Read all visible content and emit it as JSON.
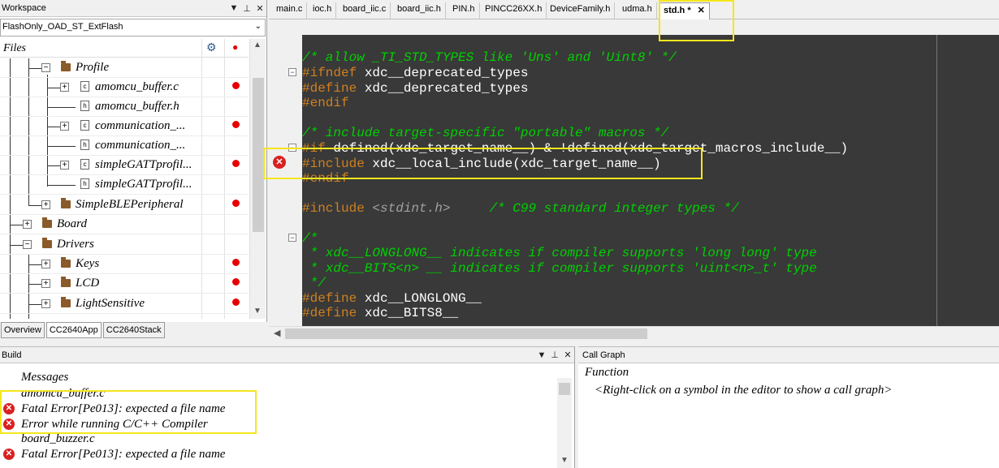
{
  "workspace": {
    "title": "Workspace",
    "pin_icon": "pin-icon",
    "configuration": "FlashOnly_OAD_ST_ExtFlash",
    "files_header": "Files",
    "tree": [
      {
        "label": "Profile",
        "type": "folder",
        "expanded": true
      },
      {
        "label": "amomcu_buffer.c",
        "type": "file"
      },
      {
        "label": "amomcu_buffer.h",
        "type": "file"
      },
      {
        "label": "communication_...",
        "type": "file"
      },
      {
        "label": "communication_...",
        "type": "file"
      },
      {
        "label": "simpleGATTprofil...",
        "type": "file"
      },
      {
        "label": "simpleGATTprofil...",
        "type": "file"
      },
      {
        "label": "SimpleBLEPeripheral",
        "type": "folder"
      },
      {
        "label": "Board",
        "type": "folder"
      },
      {
        "label": "Drivers",
        "type": "folder",
        "expanded": true
      },
      {
        "label": "Keys",
        "type": "folder"
      },
      {
        "label": "LCD",
        "type": "folder"
      },
      {
        "label": "LightSensitive",
        "type": "folder"
      }
    ],
    "tabs": [
      "Overview",
      "CC2640App",
      "CC2640Stack"
    ]
  },
  "editor": {
    "tabs": [
      "main.c",
      "ioc.h",
      "board_iic.c",
      "board_iic.h",
      "PIN.h",
      "PINCC26XX.h",
      "DeviceFamily.h",
      "udma.h",
      "std.h *"
    ],
    "close_glyph": "✕",
    "lines": {
      "l1": "/* allow _TI_STD_TYPES like 'Uns' and 'Uint8' */",
      "l2a": "#ifndef",
      "l2b": " xdc__deprecated_types",
      "l3a": "#define",
      "l3b": " xdc__deprecated_types",
      "l4": "#endif",
      "l5": "/* include target-specific \"portable\" macros */",
      "l6a": "#if",
      "l6b": " defined(xdc_target_name__) & !defined(xdc_target_macros_include__)",
      "l7a": "#include",
      "l7b": " xdc__local_include(xdc_target_name__)",
      "l8": "#endif",
      "l9a": "#include",
      "l9b": " <stdint.h>",
      "l9c": "     /* C99 standard integer types */",
      "l10": "/*",
      "l11": " * xdc__LONGLONG__ indicates if compiler supports 'long long' type",
      "l12": " * xdc__BITS<n> __ indicates if compiler supports 'uint<n>_t' type",
      "l13": " */",
      "l14a": "#define",
      "l14b": " xdc__LONGLONG__",
      "l15a": "#define",
      "l15b": " xdc__BITS8__"
    }
  },
  "build": {
    "title": "Build",
    "header": "Messages",
    "messages": [
      {
        "text": "amomcu_buffer.c",
        "error": false
      },
      {
        "text": "Fatal Error[Pe013]: expected a file name",
        "error": true
      },
      {
        "text": "Error while running C/C++ Compiler",
        "error": true
      },
      {
        "text": "board_buzzer.c",
        "error": false
      },
      {
        "text": "Fatal Error[Pe013]: expected a file name",
        "error": true
      }
    ]
  },
  "callgraph": {
    "title": "Call Graph",
    "header": "Function",
    "hint": "<Right-click on a symbol in the editor to show a call graph>"
  },
  "colors": {
    "highlight": "#f5e61b",
    "error": "#d82020",
    "code_bg": "#393939",
    "comment": "#00d000",
    "preprocessor": "#d08020"
  }
}
